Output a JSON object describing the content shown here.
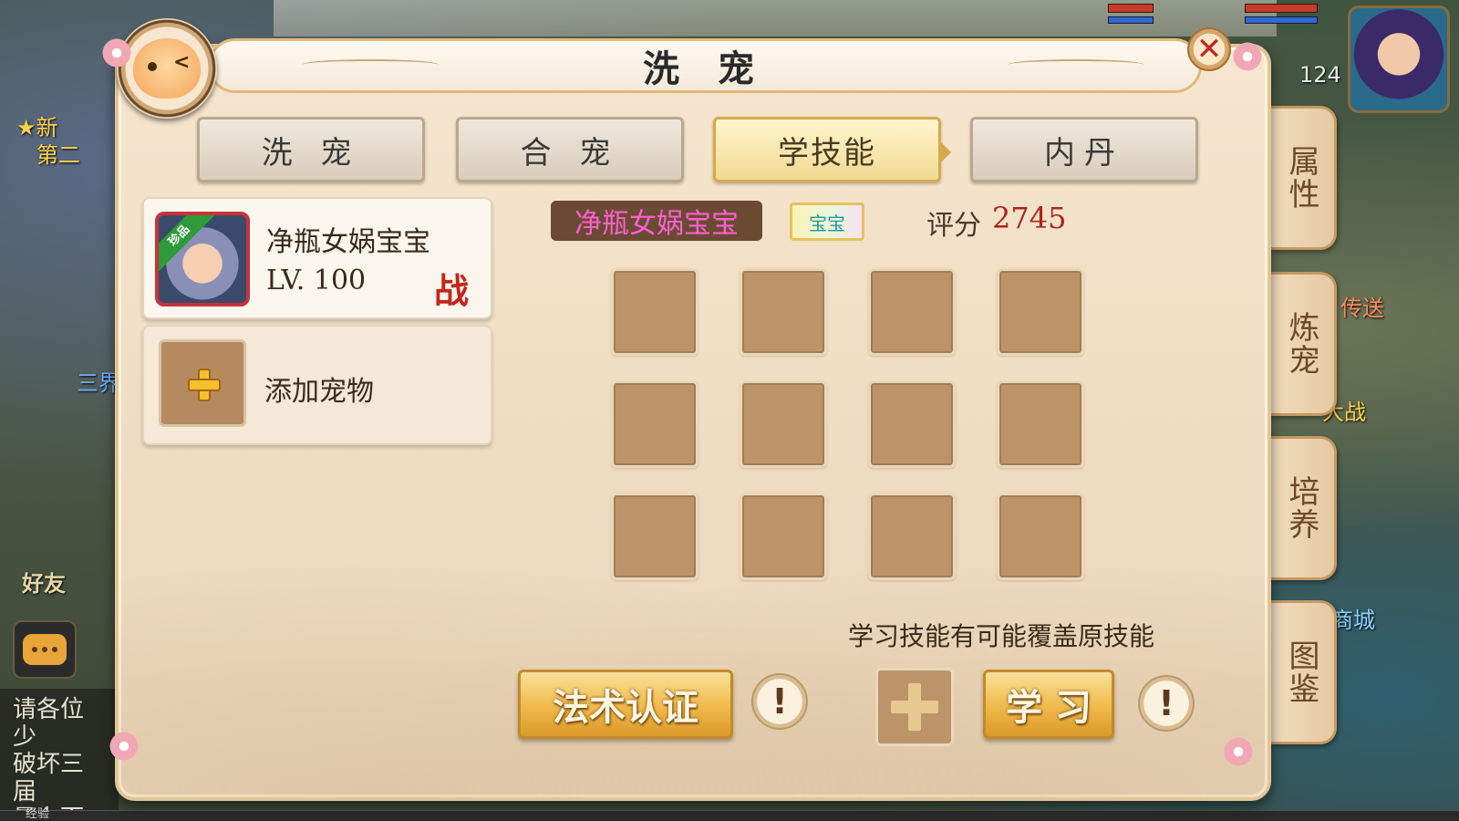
{
  "window": {
    "title": "洗 宠",
    "close_label": "✕"
  },
  "background": {
    "player_level": "124",
    "left_texts": [
      "★新",
      "第二",
      "三界"
    ],
    "right_texts": [
      "传送",
      "大战",
      "商城"
    ],
    "friends_label": "好友",
    "chat_lines": [
      "请各位少",
      "破坏三届",
      "量力而行"
    ],
    "exp_label": "经验"
  },
  "tabs": [
    {
      "label": "洗 宠",
      "active": false
    },
    {
      "label": "合 宠",
      "active": false
    },
    {
      "label": "学技能",
      "active": true
    },
    {
      "label": "内丹",
      "active": false
    }
  ],
  "side_tabs": [
    "属性",
    "炼宠",
    "培养",
    "图鉴"
  ],
  "pet": {
    "rarity": "珍品",
    "name": "净瓶女娲宝宝",
    "level_prefix": "LV.",
    "level": "100",
    "battle_mark": "战"
  },
  "add_pet": {
    "label": "添加宠物"
  },
  "pet_detail": {
    "name": "净瓶女娲宝宝",
    "type_tag": "宝宝",
    "score_label": "评分",
    "score": "2745"
  },
  "skill_grid": {
    "rows": 3,
    "cols": 4,
    "filled": 0
  },
  "hint": "学习技能有可能覆盖原技能",
  "buttons": {
    "certify_label": "法术认证",
    "learn_label": "学 习",
    "info_glyph": "!"
  },
  "colors": {
    "accent_gold": "#f0b94a",
    "pet_name_pink": "#ff5fd1",
    "score_red": "#b0231e",
    "battle_red": "#c4261c"
  }
}
